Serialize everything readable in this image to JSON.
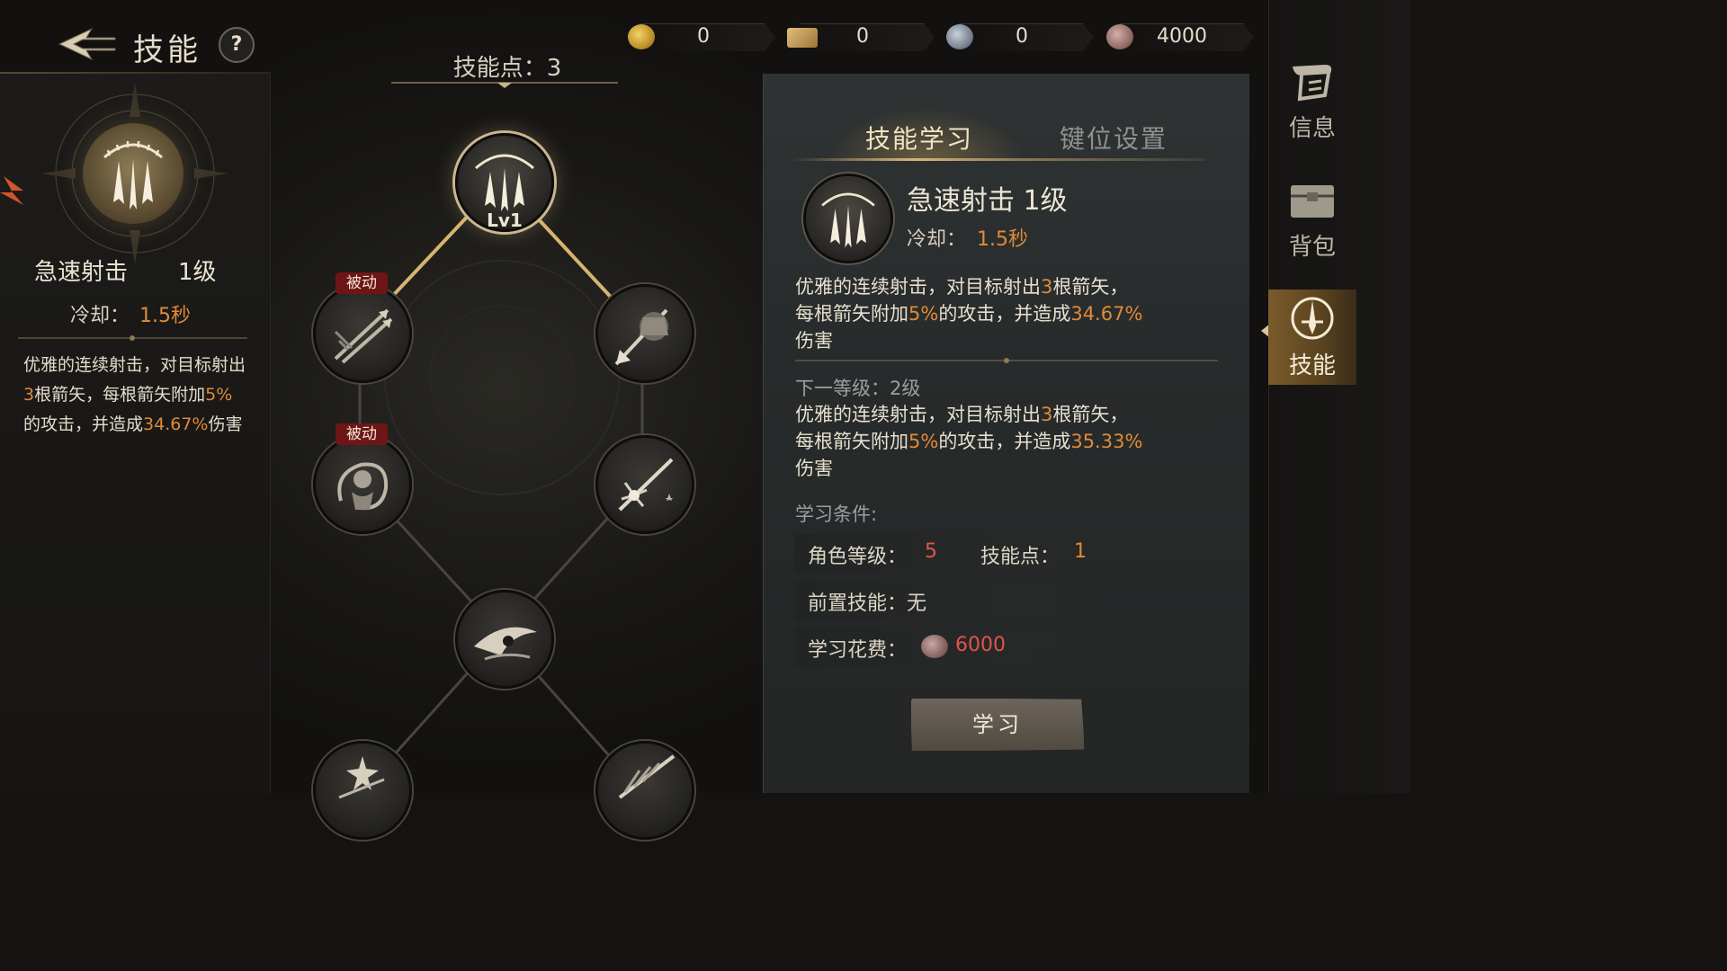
{
  "header": {
    "title": "技能",
    "help": "?",
    "skill_points_label": "技能点：3"
  },
  "currencies": [
    {
      "icon": "gold-coin-icon",
      "value": "0",
      "color": "#c9a23a"
    },
    {
      "icon": "ticket-icon",
      "value": "0",
      "color": "#b8904a"
    },
    {
      "icon": "silver-coin-icon",
      "value": "0",
      "color": "#8d98a6"
    },
    {
      "icon": "copper-coin-icon",
      "value": "4000",
      "color": "#a07a76"
    }
  ],
  "left": {
    "skill_name": "急速射击",
    "skill_level": "1级",
    "cooldown_label": "冷却：",
    "cooldown_value": "1.5秒",
    "desc_1": "优雅的连续射击，对目标射出",
    "desc_num_1": "3",
    "desc_2": "根箭矢，每根箭矢附加",
    "desc_num_2": "5%",
    "desc_3": "的攻击，并造成",
    "desc_num_3": "34.67%",
    "desc_4": "伤害"
  },
  "tree": {
    "root_level": "Lv1",
    "passive_tag": "被动",
    "nodes": [
      {
        "name": "rapid-shot",
        "icon": "triple-arrow-icon",
        "active": true
      },
      {
        "name": "passive-1",
        "icon": "crossed-arrows-icon",
        "passive": true
      },
      {
        "name": "skill-armor",
        "icon": "armored-arrow-icon"
      },
      {
        "name": "passive-2",
        "icon": "wind-spirit-icon",
        "passive": true
      },
      {
        "name": "skill-burst",
        "icon": "starburst-arrow-icon"
      },
      {
        "name": "skill-eye",
        "icon": "eagle-eye-icon"
      },
      {
        "name": "skill-7",
        "icon": "star-arrow-icon"
      },
      {
        "name": "skill-8",
        "icon": "feather-arrow-icon"
      }
    ]
  },
  "right": {
    "tabs": [
      {
        "label": "技能学习",
        "active": true
      },
      {
        "label": "键位设置",
        "active": false
      }
    ],
    "skill_title": "急速射击 1级",
    "cooldown_label": "冷却：",
    "cooldown_value": "1.5秒",
    "desc_line1_a": "优雅的连续射击，对目标射出",
    "desc_line1_num": "3",
    "desc_line1_b": "根箭矢，",
    "desc_line2_a": "每根箭矢附加",
    "desc_line2_num": "5%",
    "desc_line2_b": "的攻击，并造成",
    "desc_line2_num2": "34.67%",
    "desc_line3": "伤害",
    "next_label": "下一等级：2级",
    "next_line1_a": "优雅的连续射击，对目标射出",
    "next_line1_num": "3",
    "next_line1_b": "根箭矢，",
    "next_line2_a": "每根箭矢附加",
    "next_line2_num": "5%",
    "next_line2_b": "的攻击，并造成",
    "next_line2_num2": "35.33%",
    "next_line3": "伤害",
    "cond_title": "学习条件:",
    "cond_char_level_label": "角色等级：",
    "cond_char_level_value": "5",
    "cond_sp_label": "技能点：",
    "cond_sp_value": "1",
    "cond_prereq": "前置技能：无",
    "cond_cost_label": "学习花费：",
    "cond_cost_value": "6000",
    "learn_button": "学习"
  },
  "side_nav": [
    {
      "label": "信息",
      "icon": "scroll-icon",
      "active": false
    },
    {
      "label": "背包",
      "icon": "chest-icon",
      "active": false
    },
    {
      "label": "技能",
      "icon": "sword-emblem-icon",
      "active": true
    }
  ]
}
